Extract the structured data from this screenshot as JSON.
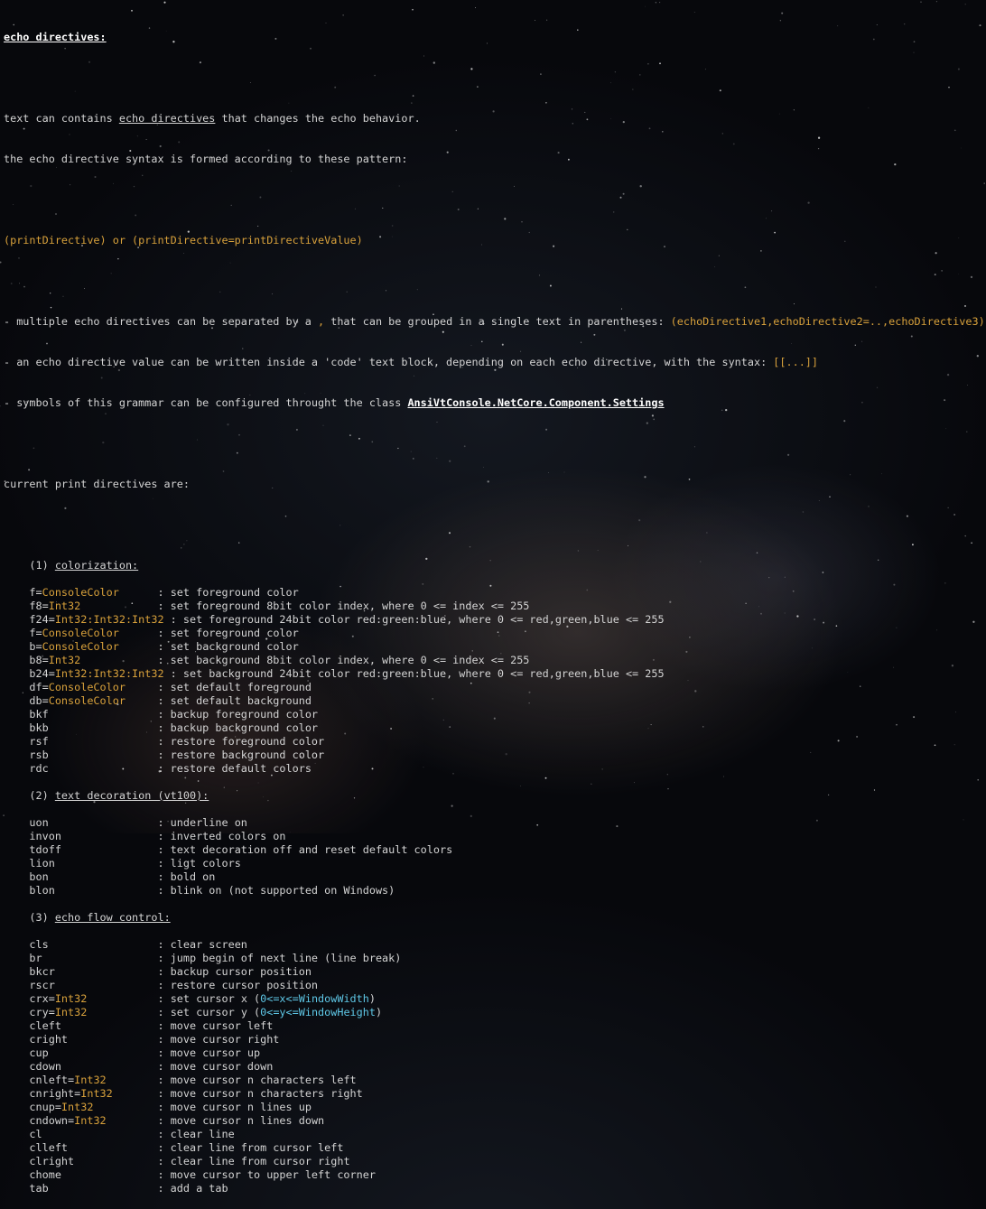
{
  "colors": {
    "text": "#d4d4d4",
    "yellow": "#d8a13b",
    "cyan": "#5ec7e6",
    "white": "#ffffff"
  },
  "title": "echo directives:",
  "intro": {
    "l1_pre": "text can contains ",
    "l1_link": "echo directives",
    "l1_post": " that changes the echo behavior.",
    "l2": "the echo directive syntax is formed according to these pattern:"
  },
  "pattern": "(printDirective) or (printDirective=printDirectiveValue)",
  "notes": {
    "n1_pre": "- multiple echo directives can be separated by a ",
    "n1_sep": ",",
    "n1_mid": " that can be grouped in a single text in parentheses: ",
    "n1_example": "(echoDirective1,echoDirective2=..,echoDirective3)",
    "n2_pre": "- an echo directive value can be written inside a 'code' text block, depending on each echo directive, with the syntax: ",
    "n2_example": "[[...]]",
    "n3_pre": "- symbols of this grammar can be configured throught the class ",
    "n3_class": "AnsiVtConsole.NetCore.Component.Settings"
  },
  "current": "current print directives are:",
  "sections": [
    {
      "num": "(1) ",
      "title": "colorization:",
      "rows": [
        {
          "name": "f",
          "param": "ConsoleColor",
          "desc": "set foreground color"
        },
        {
          "name": "f8",
          "param": "Int32",
          "desc": "set foreground 8bit color index, where 0 <= index <= 255"
        },
        {
          "name": "f24",
          "param": "Int32:Int32:Int32",
          "desc": "set foreground 24bit color red:green:blue, where 0 <= red,green,blue <= 255"
        },
        {
          "name": "f",
          "param": "ConsoleColor",
          "desc": "set foreground color"
        },
        {
          "name": "b",
          "param": "ConsoleColor",
          "desc": "set background color"
        },
        {
          "name": "b8",
          "param": "Int32",
          "desc": "set background 8bit color index, where 0 <= index <= 255"
        },
        {
          "name": "b24",
          "param": "Int32:Int32:Int32",
          "desc": "set background 24bit color red:green:blue, where 0 <= red,green,blue <= 255"
        },
        {
          "name": "df",
          "param": "ConsoleColor",
          "desc": "set default foreground"
        },
        {
          "name": "db",
          "param": "ConsoleColor",
          "desc": "set default background"
        },
        {
          "name": "bkf",
          "param": "",
          "desc": "backup foreground color"
        },
        {
          "name": "bkb",
          "param": "",
          "desc": "backup background color"
        },
        {
          "name": "rsf",
          "param": "",
          "desc": "restore foreground color"
        },
        {
          "name": "rsb",
          "param": "",
          "desc": "restore background color"
        },
        {
          "name": "rdc",
          "param": "",
          "desc": "restore default colors"
        }
      ]
    },
    {
      "num": "(2) ",
      "title": "text decoration (vt100):",
      "rows": [
        {
          "name": "uon",
          "param": "",
          "desc": "underline on"
        },
        {
          "name": "invon",
          "param": "",
          "desc": "inverted colors on"
        },
        {
          "name": "tdoff",
          "param": "",
          "desc": "text decoration off and reset default colors"
        },
        {
          "name": "lion",
          "param": "",
          "desc": "ligt colors"
        },
        {
          "name": "bon",
          "param": "",
          "desc": "bold on"
        },
        {
          "name": "blon",
          "param": "",
          "desc": "blink on (not supported on Windows)"
        }
      ]
    },
    {
      "num": "(3) ",
      "title": "echo flow control:",
      "rows": [
        {
          "name": "cls",
          "param": "",
          "desc": "clear screen"
        },
        {
          "name": "br",
          "param": "",
          "desc": "jump begin of next line (line break)"
        },
        {
          "name": "bkcr",
          "param": "",
          "desc": "backup cursor position"
        },
        {
          "name": "rscr",
          "param": "",
          "desc": "restore cursor position"
        },
        {
          "name": "crx",
          "param": "Int32",
          "desc": "set cursor x (",
          "cyan": "0<=x<=WindowWidth",
          "desc_post": ")"
        },
        {
          "name": "cry",
          "param": "Int32",
          "desc": "set cursor y (",
          "cyan": "0<=y<=WindowHeight",
          "desc_post": ")"
        },
        {
          "name": "cleft",
          "param": "",
          "desc": "move cursor left"
        },
        {
          "name": "cright",
          "param": "",
          "desc": "move cursor right"
        },
        {
          "name": "cup",
          "param": "",
          "desc": "move cursor up"
        },
        {
          "name": "cdown",
          "param": "",
          "desc": "move cursor down"
        },
        {
          "name": "cnleft",
          "param": "Int32",
          "desc": "move cursor n characters left"
        },
        {
          "name": "cnright",
          "param": "Int32",
          "desc": "move cursor n characters right"
        },
        {
          "name": "cnup",
          "param": "Int32",
          "desc": "move cursor n lines up"
        },
        {
          "name": "cndown",
          "param": "Int32",
          "desc": "move cursor n lines down"
        },
        {
          "name": "cl",
          "param": "",
          "desc": "clear line"
        },
        {
          "name": "clleft",
          "param": "",
          "desc": "clear line from cursor left"
        },
        {
          "name": "clright",
          "param": "",
          "desc": "clear line from cursor right"
        },
        {
          "name": "chome",
          "param": "",
          "desc": "move cursor to upper left corner"
        },
        {
          "name": "tab",
          "param": "",
          "desc": "add a tab"
        }
      ]
    }
  ]
}
